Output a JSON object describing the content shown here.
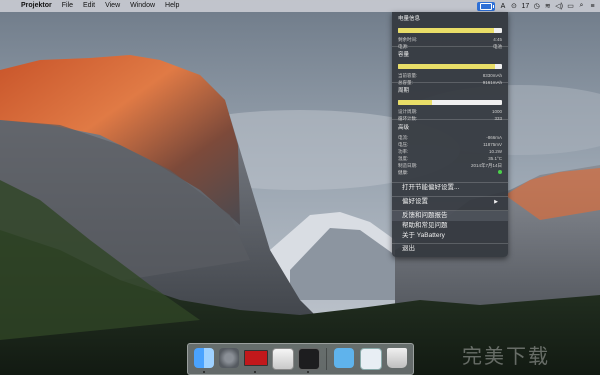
{
  "menubar": {
    "apple_glyph": "",
    "app_name": "Projektor",
    "items": [
      "File",
      "Edit",
      "View",
      "Window",
      "Help"
    ],
    "status": {
      "icon_a": "A",
      "icon_b": "⊙",
      "icon_c": "≋",
      "number": "17"
    }
  },
  "panel": {
    "section1": {
      "title": "电量信息",
      "fill_percent": 92,
      "rows": [
        [
          "剩余时间:",
          "4:45"
        ],
        [
          "电源:",
          "电池"
        ]
      ]
    },
    "section2": {
      "title": "容量",
      "fill_percent": 93,
      "rows": [
        [
          "当前容量:",
          "8330mAh"
        ],
        [
          "总容量:",
          "9161mAh"
        ]
      ]
    },
    "section3": {
      "title": "周期",
      "fill_percent": 33,
      "rows": [
        [
          "设计周期:",
          "1000"
        ],
        [
          "循环计数:",
          "333"
        ]
      ]
    },
    "section4": {
      "title": "高级",
      "rows": [
        [
          "电流:",
          "-866mA"
        ],
        [
          "电压:",
          "11875mV"
        ],
        [
          "功率:",
          "10.2W"
        ],
        [
          "温度:",
          "35.1°C"
        ],
        [
          "制造日期:",
          "2014年7月14日"
        ],
        [
          "健康:",
          ""
        ]
      ]
    },
    "menu": {
      "prefs_open": "打开节能偏好设置...",
      "prefs": "偏好设置",
      "feedback": "反馈和问题报告",
      "help": "帮助和常见问题",
      "about": "关于 YaBattery",
      "quit": "退出"
    }
  },
  "dock": {
    "apps": [
      "finder-icon",
      "system-preferences-icon",
      "projektor-icon",
      "preview-icon",
      "terminal-icon",
      "folder-icon",
      "documents-icon",
      "trash-icon"
    ]
  },
  "watermark": "完美下载",
  "colors": {
    "bar_fill": "#e9de68",
    "panel_bg": "#34383e",
    "battery_icon_bg": "#2d6fd6"
  }
}
